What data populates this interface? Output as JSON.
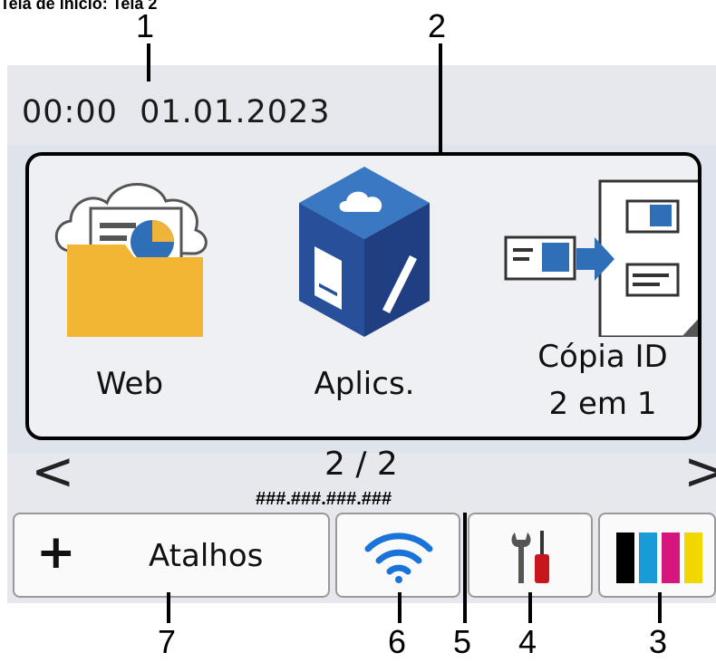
{
  "caption": "Tela de início: Tela 2",
  "status": {
    "datetime": "00:00  01.01.2023"
  },
  "apps": [
    {
      "label_line1": "Web",
      "label_line2": ""
    },
    {
      "label_line1": "Aplics.",
      "label_line2": ""
    },
    {
      "label_line1": "Cópia ID",
      "label_line2": "2 em 1"
    }
  ],
  "pager": {
    "page": "2 / 2",
    "prev": "<",
    "next": ">"
  },
  "ip_address": "###.###.###.###",
  "bottom_bar": {
    "shortcuts_plus": "+",
    "shortcuts_label": "Atalhos"
  },
  "ink_colors": [
    "#000000",
    "#1a9ad6",
    "#d6157d",
    "#f2d600"
  ],
  "callouts": [
    "1",
    "2",
    "3",
    "4",
    "5",
    "6",
    "7"
  ]
}
